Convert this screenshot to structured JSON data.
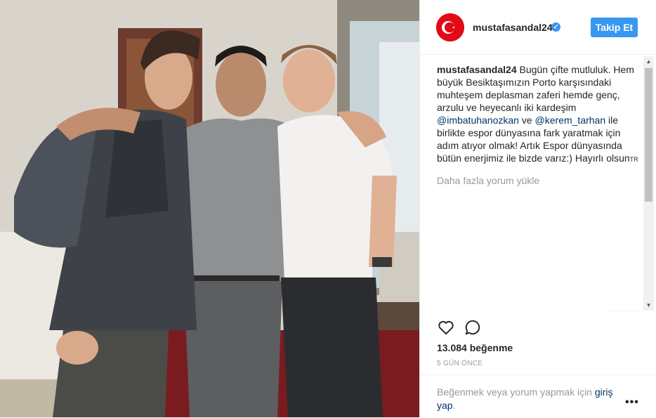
{
  "header": {
    "username": "mustafasandal24",
    "verified_icon": "verified-check-icon",
    "follow_label": "Takip Et",
    "avatar_icon": "turkish-flag-icon"
  },
  "caption": {
    "username": "mustafasandal24",
    "part1": " Bugün çifte mutluluk. Hem büyük Besiktaşımızın Porto karşısındaki muhteşem deplasman zaferi hemde genç, arzulu ve heyecanlı iki kardeşim ",
    "mention1": "@imbatuhanozkan",
    "part2": " ve ",
    "mention2": "@kerem_tarhan",
    "part3": " ile birlikte espor dünyasına fark yaratmak için adım atıyor olmak! Artık Espor dünyasında bütün enerjimiz ile bizde varız:) Hayırlı olsun",
    "part3_suffix": "TR"
  },
  "load_more": "Daha fazla yorum yükle",
  "likes": "13.084 beğenme",
  "time": "5 GÜN ÖNCE",
  "footer": {
    "text": "Beğenmek veya yorum yapmak için ",
    "link": "giriş yap",
    "link_end": "."
  },
  "icons": {
    "like": "heart-icon",
    "comment": "comment-icon",
    "more": "more-options-icon"
  },
  "colors": {
    "accent": "#3897f0",
    "mention": "#003569",
    "muted": "#999999",
    "flag": "#e30a17"
  }
}
